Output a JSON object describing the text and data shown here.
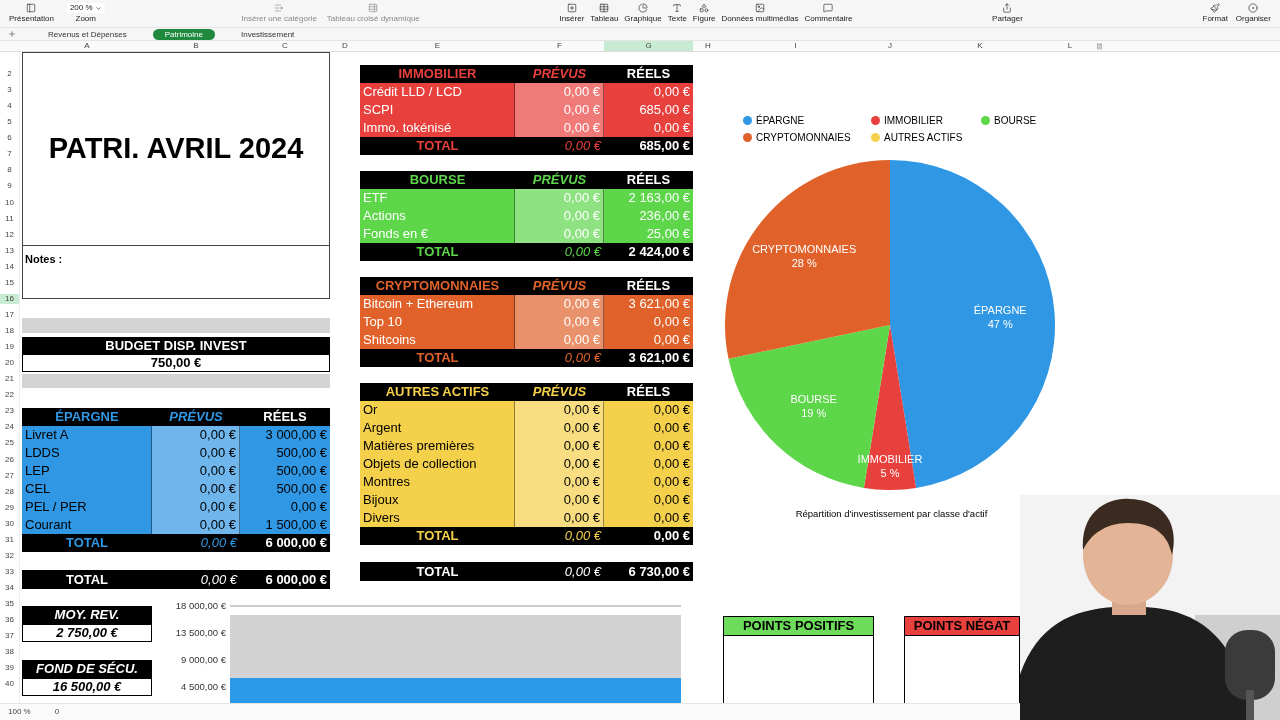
{
  "toolbar": {
    "presentation": {
      "label": "Présentation"
    },
    "zoom": {
      "value": "200 %",
      "label": "Zoom"
    },
    "table_tools": [
      {
        "label": "Insérer une catégorie",
        "disabled": true
      },
      {
        "label": "Tableau croisé dynamique",
        "disabled": true
      }
    ],
    "insert_tools": [
      {
        "label": "Insérer",
        "disabled": false
      },
      {
        "label": "Tableau",
        "disabled": false
      },
      {
        "label": "Graphique",
        "disabled": false
      },
      {
        "label": "Texte",
        "disabled": false
      },
      {
        "label": "Figure",
        "disabled": false
      },
      {
        "label": "Données multimédias",
        "disabled": false
      },
      {
        "label": "Commentaire",
        "disabled": false
      }
    ],
    "share": {
      "label": "Partager"
    },
    "right_tools": [
      {
        "label": "Format",
        "disabled": false
      },
      {
        "label": "Organiser",
        "disabled": false
      }
    ]
  },
  "sheet_tabs": [
    {
      "label": "Revenus et Dépenses",
      "selected": false
    },
    {
      "label": "Patrimoine",
      "selected": true
    },
    {
      "label": "Investissement",
      "selected": false
    }
  ],
  "column_headers": [
    {
      "label": "A",
      "selected": false
    },
    {
      "label": "B",
      "selected": false
    },
    {
      "label": "C",
      "selected": false
    },
    {
      "label": "D",
      "selected": false
    },
    {
      "label": "E",
      "selected": false
    },
    {
      "label": "F",
      "selected": false
    },
    {
      "label": "G",
      "selected": true
    },
    {
      "label": "H",
      "selected": false
    },
    {
      "label": "I",
      "selected": false
    },
    {
      "label": "J",
      "selected": false
    },
    {
      "label": "K",
      "selected": false
    },
    {
      "label": "L",
      "selected": false
    }
  ],
  "row_headers": [
    {
      "label": "2",
      "selected": false
    },
    {
      "label": "3",
      "selected": false
    },
    {
      "label": "4",
      "selected": false
    },
    {
      "label": "5",
      "selected": false
    },
    {
      "label": "6",
      "selected": false
    },
    {
      "label": "7",
      "selected": false
    },
    {
      "label": "8",
      "selected": false
    },
    {
      "label": "9",
      "selected": false
    },
    {
      "label": "10",
      "selected": false
    },
    {
      "label": "11",
      "selected": false
    },
    {
      "label": "12",
      "selected": false
    },
    {
      "label": "13",
      "selected": false
    },
    {
      "label": "14",
      "selected": false
    },
    {
      "label": "15",
      "selected": false
    },
    {
      "label": "16",
      "selected": true
    },
    {
      "label": "17",
      "selected": false
    },
    {
      "label": "18",
      "selected": false
    },
    {
      "label": "19",
      "selected": false
    },
    {
      "label": "20",
      "selected": false
    },
    {
      "label": "21",
      "selected": false
    },
    {
      "label": "22",
      "selected": false
    },
    {
      "label": "23",
      "selected": false
    },
    {
      "label": "24",
      "selected": false
    },
    {
      "label": "25",
      "selected": false
    },
    {
      "label": "26",
      "selected": false
    },
    {
      "label": "27",
      "selected": false
    },
    {
      "label": "28",
      "selected": false
    },
    {
      "label": "29",
      "selected": false
    },
    {
      "label": "30",
      "selected": false
    },
    {
      "label": "31",
      "selected": false
    },
    {
      "label": "32",
      "selected": false
    },
    {
      "label": "33",
      "selected": false
    },
    {
      "label": "34",
      "selected": false
    },
    {
      "label": "35",
      "selected": false
    },
    {
      "label": "36",
      "selected": false
    },
    {
      "label": "37",
      "selected": false
    },
    {
      "label": "38",
      "selected": false
    },
    {
      "label": "39",
      "selected": false
    },
    {
      "label": "40",
      "selected": false
    }
  ],
  "title": "PATRI. AVRIL 2024",
  "notes_label": "Notes :",
  "budget": {
    "title": "BUDGET DISP. INVEST",
    "value": "750,00 €"
  },
  "epargne": {
    "title": "ÉPARGNE",
    "color": "#2f97e4",
    "light_text": false,
    "prevus_label": "PRÉVUS",
    "reels_label": "RÉELS",
    "rows": [
      {
        "label": "Livret A",
        "prevus": "0,00 €",
        "reels": "3 000,00 €"
      },
      {
        "label": "LDDS",
        "prevus": "0,00 €",
        "reels": "500,00 €"
      },
      {
        "label": "LEP",
        "prevus": "0,00 €",
        "reels": "500,00 €"
      },
      {
        "label": "CEL",
        "prevus": "0,00 €",
        "reels": "500,00 €"
      },
      {
        "label": "PEL / PER",
        "prevus": "0,00 €",
        "reels": "0,00 €"
      },
      {
        "label": "Courant",
        "prevus": "0,00 €",
        "reels": "1 500,00 €"
      }
    ],
    "total": {
      "label": "TOTAL",
      "prevus": "0,00 €",
      "reels": "6 000,00 €"
    }
  },
  "epargne_grand_total": {
    "label": "TOTAL",
    "prevus": "0,00 €",
    "reels": "6 000,00 €"
  },
  "kpis": [
    {
      "title": "MOY. REV.",
      "value": "2 750,00 €"
    },
    {
      "title": "FOND DE SÉCU.",
      "value": "16 500,00 €"
    }
  ],
  "sections": [
    {
      "title": "IMMOBILIER",
      "color": "#e8403d",
      "light_text": true,
      "prevus_label": "PRÉVUS",
      "reels_label": "RÉELS",
      "rows": [
        {
          "label": "Crédit LLD / LCD",
          "prevus": "0,00 €",
          "reels": "0,00 €"
        },
        {
          "label": "SCPI",
          "prevus": "0,00 €",
          "reels": "685,00 €"
        },
        {
          "label": "Immo. tokénisé",
          "prevus": "0,00 €",
          "reels": "0,00 €"
        }
      ],
      "total": {
        "label": "TOTAL",
        "prevus": "0,00 €",
        "reels": "685,00 €"
      }
    },
    {
      "title": "BOURSE",
      "color": "#5dd64a",
      "light_text": true,
      "prevus_label": "PRÉVUS",
      "reels_label": "RÉELS",
      "rows": [
        {
          "label": "ETF",
          "prevus": "0,00 €",
          "reels": "2 163,00 €"
        },
        {
          "label": "Actions",
          "prevus": "0,00 €",
          "reels": "236,00 €"
        },
        {
          "label": "Fonds en €",
          "prevus": "0,00 €",
          "reels": "25,00 €"
        }
      ],
      "total": {
        "label": "TOTAL",
        "prevus": "0,00 €",
        "reels": "2 424,00 €"
      }
    },
    {
      "title": "CRYPTOMONNAIES",
      "color": "#e0622a",
      "light_text": true,
      "prevus_label": "PRÉVUS",
      "reels_label": "RÉELS",
      "rows": [
        {
          "label": "Bitcoin + Ethereum",
          "prevus": "0,00 €",
          "reels": "3 621,00 €"
        },
        {
          "label": "Top 10",
          "prevus": "0,00 €",
          "reels": "0,00 €"
        },
        {
          "label": "Shitcoins",
          "prevus": "0,00 €",
          "reels": "0,00 €"
        }
      ],
      "total": {
        "label": "TOTAL",
        "prevus": "0,00 €",
        "reels": "3 621,00 €"
      }
    },
    {
      "title": "AUTRES ACTIFS",
      "color": "#f5d04a",
      "light_text": false,
      "prevus_label": "PRÉVUS",
      "reels_label": "RÉELS",
      "rows": [
        {
          "label": "Or",
          "prevus": "0,00 €",
          "reels": "0,00 €"
        },
        {
          "label": "Argent",
          "prevus": "0,00 €",
          "reels": "0,00 €"
        },
        {
          "label": "Matières premières",
          "prevus": "0,00 €",
          "reels": "0,00 €"
        },
        {
          "label": "Objets de collection",
          "prevus": "0,00 €",
          "reels": "0,00 €"
        },
        {
          "label": "Montres",
          "prevus": "0,00 €",
          "reels": "0,00 €"
        },
        {
          "label": "Bijoux",
          "prevus": "0,00 €",
          "reels": "0,00 €"
        },
        {
          "label": "Divers",
          "prevus": "0,00 €",
          "reels": "0,00 €"
        }
      ],
      "total": {
        "label": "TOTAL",
        "prevus": "0,00 €",
        "reels": "0,00 €"
      }
    }
  ],
  "grand_total": {
    "label": "TOTAL",
    "prevus": "0,00 €",
    "reels": "6 730,00 €"
  },
  "savings_chart": {
    "chart_data": {
      "type": "bar",
      "stacked": true,
      "ylim": [
        0,
        18000
      ],
      "series": [
        {
          "color": "#2a9ae8",
          "values": [
            6000
          ]
        },
        {
          "color": "#d3d3d3",
          "values": [
            10500
          ]
        }
      ],
      "yticks": [
        {
          "value": 4500,
          "label": "4 500,00 €"
        },
        {
          "value": 9000,
          "label": "9 000,00 €"
        },
        {
          "value": 13500,
          "label": "13 500,00 €"
        },
        {
          "value": 18000,
          "label": "18 000,00 €"
        }
      ]
    }
  },
  "allocation_chart": {
    "legend": [
      {
        "label": "ÉPARGNE",
        "color": "#2f97e4"
      },
      {
        "label": "IMMOBILIER",
        "color": "#e8403d"
      },
      {
        "label": "BOURSE",
        "color": "#5dd64a"
      },
      {
        "label": "CRYPTOMONNAIES",
        "color": "#e0622a"
      },
      {
        "label": "AUTRES ACTIFS",
        "color": "#f5d04a"
      }
    ],
    "chart_data": {
      "type": "pie",
      "title": "Répartition d'investissement par classe d'actif",
      "categories": [
        "ÉPARGNE",
        "IMMOBILIER",
        "BOURSE",
        "CRYPTOMONNAIES"
      ],
      "values": [
        47,
        5,
        19,
        28
      ],
      "value_labels": [
        "47 %",
        "5 %",
        "19 %",
        "28 %"
      ]
    }
  },
  "points": [
    {
      "title": "POINTS POSITIFS",
      "color": "#6ddc5a"
    },
    {
      "title": "POINTS NÉGAT",
      "color": "#e8403d"
    }
  ],
  "status_bar": {
    "zoom": "100 %",
    "count": "0"
  }
}
